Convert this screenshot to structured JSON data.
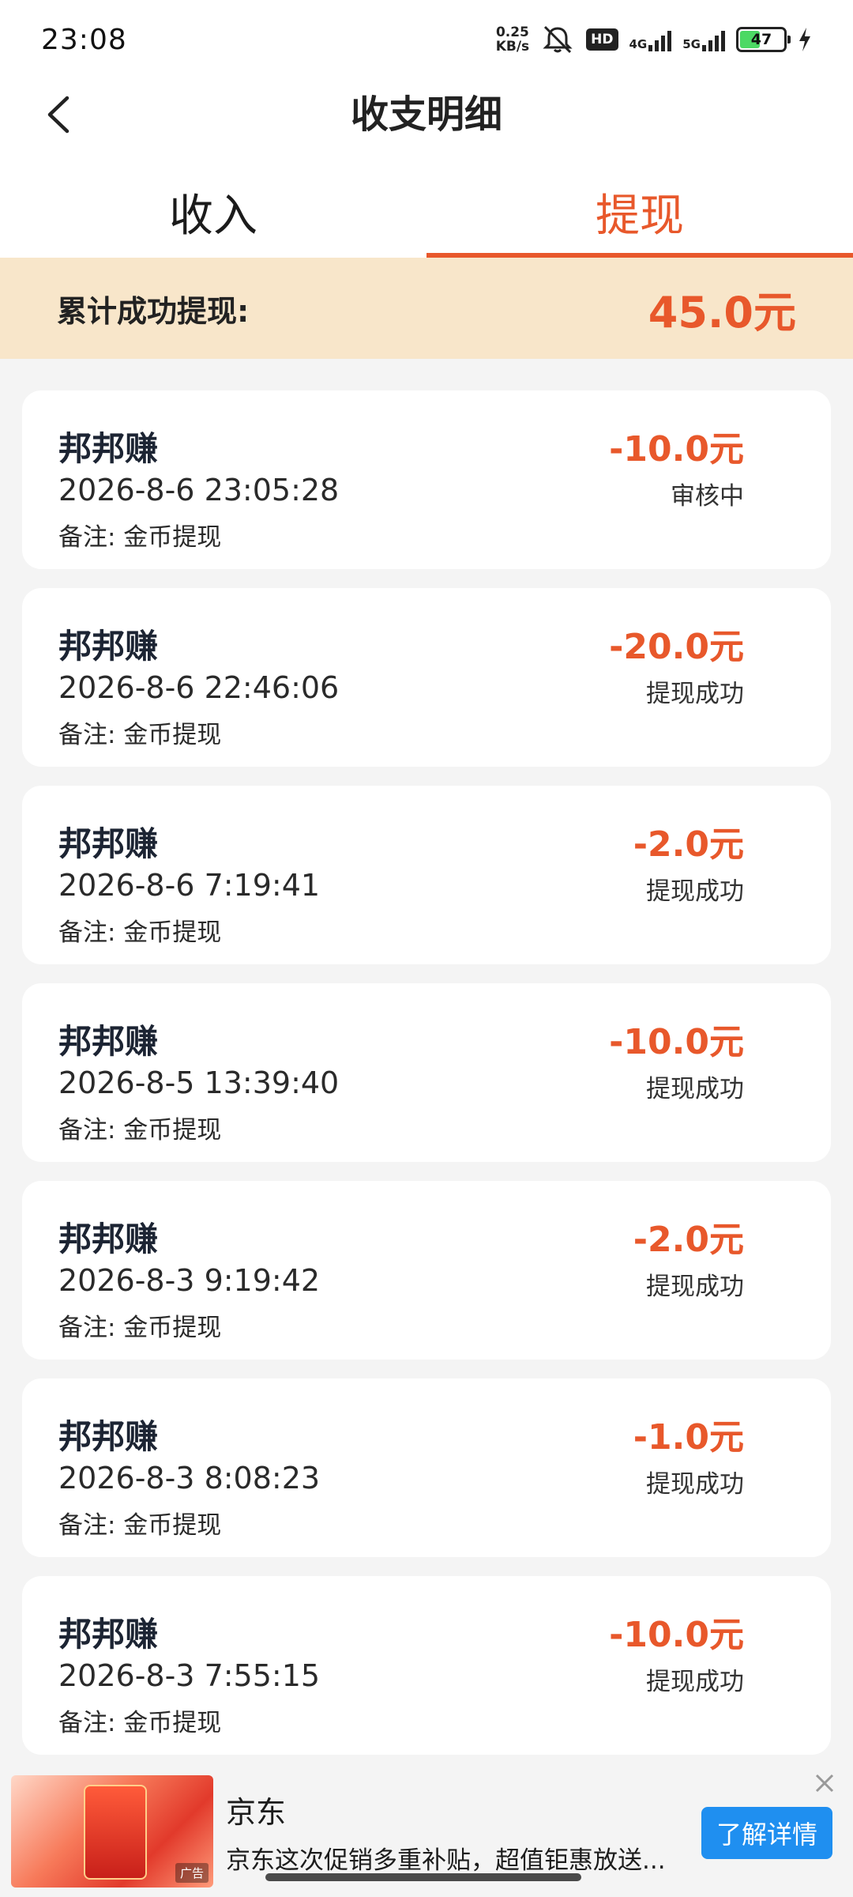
{
  "status_bar": {
    "time": "23:08",
    "net_speed_value": "0.25",
    "net_speed_unit": "KB/s",
    "hd_label": "HD",
    "net1_label": "4G",
    "net2_label": "5G",
    "battery_level": "47",
    "battery_fraction": 0.47,
    "battery_color": "#4cd964",
    "icons": [
      "mute-bell-icon",
      "signal-icon",
      "battery-icon",
      "charging-bolt-icon"
    ]
  },
  "header": {
    "title": "收支明细",
    "back_icon": "chevron-left-icon"
  },
  "tabs": [
    {
      "label": "收入",
      "active": false
    },
    {
      "label": "提现",
      "active": true
    }
  ],
  "summary": {
    "label": "累计成功提现:",
    "amount": "45.0元"
  },
  "accent_color": "#e8582b",
  "records": [
    {
      "source": "邦邦赚",
      "datetime": "2026-8-6 23:05:28",
      "note": "备注: 金币提现",
      "amount": "-10.0元",
      "status": "审核中"
    },
    {
      "source": "邦邦赚",
      "datetime": "2026-8-6 22:46:06",
      "note": "备注: 金币提现",
      "amount": "-20.0元",
      "status": "提现成功"
    },
    {
      "source": "邦邦赚",
      "datetime": "2026-8-6 7:19:41",
      "note": "备注: 金币提现",
      "amount": "-2.0元",
      "status": "提现成功"
    },
    {
      "source": "邦邦赚",
      "datetime": "2026-8-5 13:39:40",
      "note": "备注: 金币提现",
      "amount": "-10.0元",
      "status": "提现成功"
    },
    {
      "source": "邦邦赚",
      "datetime": "2026-8-3 9:19:42",
      "note": "备注: 金币提现",
      "amount": "-2.0元",
      "status": "提现成功"
    },
    {
      "source": "邦邦赚",
      "datetime": "2026-8-3 8:08:23",
      "note": "备注: 金币提现",
      "amount": "-1.0元",
      "status": "提现成功"
    },
    {
      "source": "邦邦赚",
      "datetime": "2026-8-3 7:55:15",
      "note": "备注: 金币提现",
      "amount": "-10.0元",
      "status": "提现成功"
    }
  ],
  "ad": {
    "brand": "京东",
    "description": "京东这次促销多重补贴，超值钜惠放送...",
    "button_label": "了解详情",
    "ad_tag": "广告",
    "button_color": "#1f8ff0"
  }
}
